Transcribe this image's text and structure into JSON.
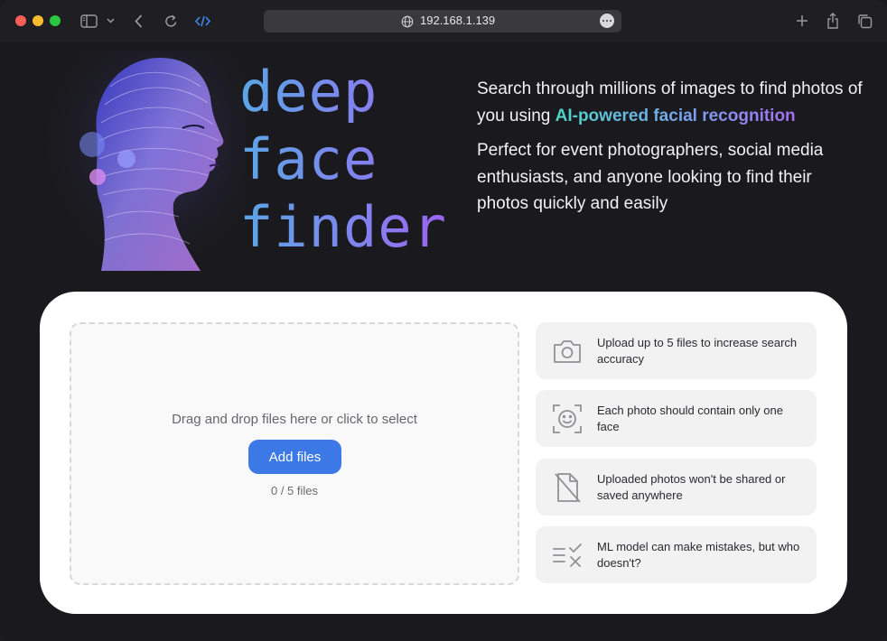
{
  "browser": {
    "url": "192.168.1.139",
    "icons": [
      "sidebar-icon",
      "chevron-down-icon",
      "back-icon",
      "reload-icon",
      "code-icon",
      "globe-icon",
      "more-icon",
      "new-tab-icon",
      "share-icon",
      "tabs-overview-icon"
    ]
  },
  "hero": {
    "logo_lines": [
      "deep",
      "face",
      "finder"
    ],
    "para1_pre": "Search through millions of images to find photos of you using ",
    "para1_highlight": "AI-powered facial recognition",
    "para2": "Perfect for event photographers, social media enthusiasts, and anyone looking to find their photos quickly and easily"
  },
  "upload": {
    "drop_text": "Drag and drop files here or click to select",
    "button": "Add files",
    "count": "0 / 5 files"
  },
  "tips": [
    {
      "icon": "camera-icon",
      "text": "Upload up to 5 files to increase search accuracy"
    },
    {
      "icon": "face-scan-icon",
      "text": "Each photo should contain only one face"
    },
    {
      "icon": "no-file-icon",
      "text": "Uploaded photos won't be shared or saved anywhere"
    },
    {
      "icon": "checklist-icon",
      "text": "ML model can make mistakes, but who doesn't?"
    }
  ],
  "colors": {
    "accent": "#3c78e6",
    "page_bg": "#1a1a1e",
    "card_bg": "#ffffff"
  }
}
